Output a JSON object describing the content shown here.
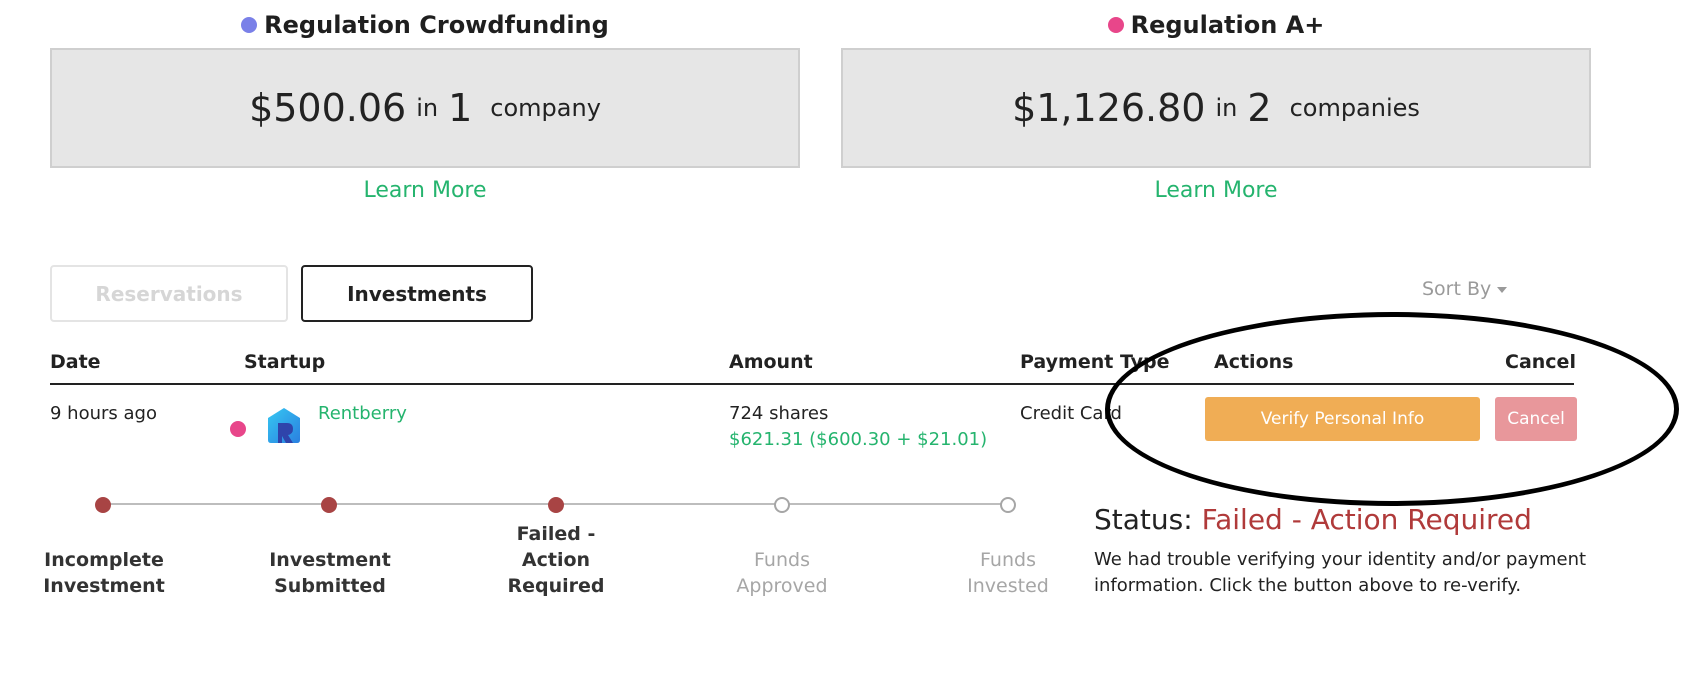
{
  "summary": [
    {
      "title": "Regulation Crowdfunding",
      "dot_color": "#7a80e8",
      "amount": "$500.06",
      "in_word": "in",
      "count": "1",
      "unit": "company",
      "link": "Learn More"
    },
    {
      "title": "Regulation A+",
      "dot_color": "#e8468a",
      "amount": "$1,126.80",
      "in_word": "in",
      "count": "2",
      "unit": "companies",
      "link": "Learn More"
    }
  ],
  "tabs": {
    "reservations": "Reservations",
    "investments": "Investments",
    "active": "investments"
  },
  "sort_by": "Sort By",
  "table": {
    "headers": {
      "date": "Date",
      "startup": "Startup",
      "amount": "Amount",
      "payment_type": "Payment Type",
      "actions": "Actions",
      "cancel": "Cancel"
    },
    "row": {
      "date": "9 hours ago",
      "regulation_dot_color": "#e8468a",
      "startup_icon": "rentberry-logo-icon",
      "startup_name": "Rentberry",
      "shares": "724 shares",
      "amount_detail": "$621.31 ($600.30 + $21.01)",
      "payment_type": "Credit Card",
      "action_button": "Verify Personal Info",
      "cancel_button": "Cancel"
    }
  },
  "progress": {
    "steps": [
      {
        "label_lines": [
          "Incomplete",
          "Investment"
        ],
        "state": "done"
      },
      {
        "label_lines": [
          "Investment",
          "Submitted"
        ],
        "state": "done"
      },
      {
        "label_lines": [
          "Failed -",
          "Action",
          "Required"
        ],
        "state": "done"
      },
      {
        "label_lines": [
          "Funds",
          "Approved"
        ],
        "state": "todo"
      },
      {
        "label_lines": [
          "Funds",
          "Invested"
        ],
        "state": "todo"
      }
    ]
  },
  "status": {
    "label": "Status:",
    "value": "Failed - Action Required",
    "description": "We had trouble verifying your identity and/or payment information. Click the button above to re-verify."
  },
  "colors": {
    "accent_green": "#25b46e",
    "status_red": "#b03a3a",
    "verify_orange": "#f0ad55",
    "cancel_pink": "#e8979b",
    "progress_done": "#a84444",
    "annotation_ellipse": "#000000"
  }
}
